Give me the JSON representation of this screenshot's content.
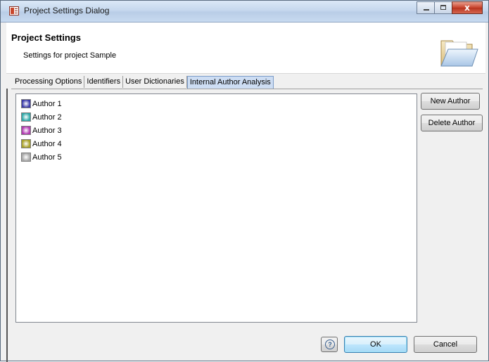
{
  "window": {
    "title": "Project Settings Dialog",
    "close_label": "x"
  },
  "header": {
    "title": "Project Settings",
    "subtitle": "Settings for project Sample"
  },
  "tabs": [
    {
      "label": "Processing Options"
    },
    {
      "label": "Identifiers"
    },
    {
      "label": "User Dictionaries"
    },
    {
      "label": "Internal Author Analysis",
      "active": true
    }
  ],
  "authors": [
    {
      "label": "Author 1",
      "color": "#3a3aa8"
    },
    {
      "label": "Author 2",
      "color": "#2fa8a8"
    },
    {
      "label": "Author 3",
      "color": "#b03ab0"
    },
    {
      "label": "Author 4",
      "color": "#a8a028"
    },
    {
      "label": "Author 5",
      "color": "#a8a8a8"
    }
  ],
  "buttons": {
    "new_author": "New Author",
    "delete_author": "Delete Author",
    "help": "?",
    "ok": "OK",
    "cancel": "Cancel"
  }
}
